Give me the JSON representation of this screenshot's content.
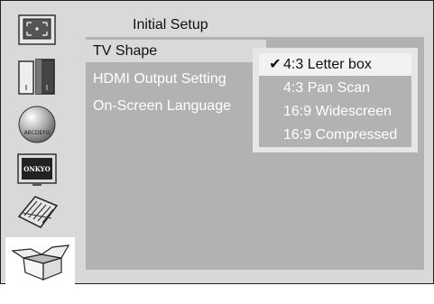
{
  "header": {
    "title": "Initial Setup"
  },
  "sidebar": {
    "icons": [
      {
        "name": "display-setup-icon"
      },
      {
        "name": "speaker-setup-icon"
      },
      {
        "name": "language-globe-icon",
        "text": "ABCDEFG"
      },
      {
        "name": "onkyo-tv-icon",
        "text": "ONKYO"
      },
      {
        "name": "keyboard-icon"
      },
      {
        "name": "open-box-icon"
      }
    ]
  },
  "menu": {
    "items": [
      {
        "label": "TV Shape",
        "selected": true
      },
      {
        "label": "HDMI Output Setting",
        "selected": false
      },
      {
        "label": "On-Screen Language",
        "selected": false
      }
    ]
  },
  "submenu": {
    "options": [
      {
        "label": "4:3 Letter box",
        "checked": true,
        "check": "✔"
      },
      {
        "label": "4:3 Pan Scan",
        "checked": false,
        "check": ""
      },
      {
        "label": "16:9 Widescreen",
        "checked": false,
        "check": ""
      },
      {
        "label": "16:9 Compressed",
        "checked": false,
        "check": ""
      }
    ]
  },
  "colors": {
    "background": "#d9d9d9",
    "panel": "#b2b2b2",
    "highlight": "#f2f2f2",
    "text_light": "#ffffff",
    "text_dark": "#111111"
  }
}
